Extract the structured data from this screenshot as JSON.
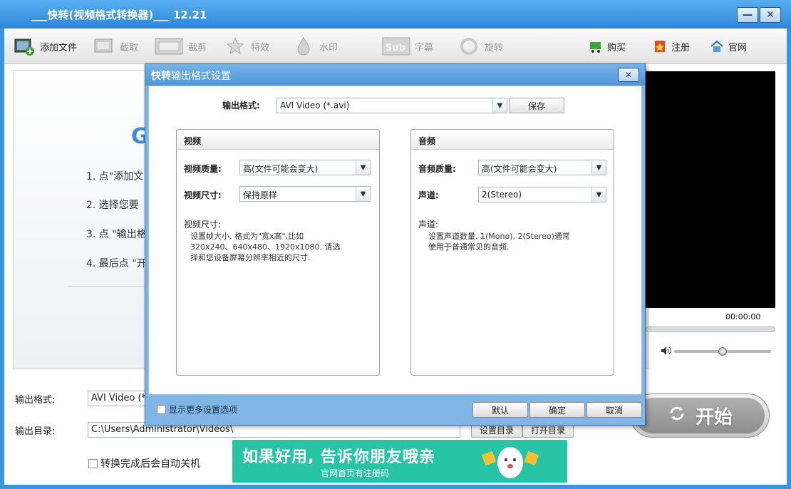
{
  "app": {
    "title": "___快转(视频格式转换器)___ 12.21",
    "minimize_icon": "minimize-icon",
    "close_icon": "close-icon"
  },
  "toolbar": {
    "add_file": "添加文件",
    "clip": "截取",
    "crop": "裁剪",
    "effects": "特效",
    "watermark": "水印",
    "subtitle": "字幕",
    "rotate": "旋转",
    "buy": "购买",
    "register": "注册",
    "website": "官网"
  },
  "guide": {
    "big_letter": "G",
    "step1": "1. 点\"添加文",
    "step2": "2. 选择您要",
    "step3": "3. 点 \"输出格",
    "step4": "4. 最后点 \"开"
  },
  "preview": {
    "time": "00:00:00",
    "progress": 0,
    "volume": 0.5
  },
  "bottom": {
    "output_format_label": "输出格式:",
    "output_format_value": "AVI Video (*.",
    "output_dir_label": "输出目录:",
    "output_dir_value": "C:\\Users\\Administrator\\Videos\\",
    "set_dir_button": "设置目录",
    "open_dir_button": "打开目录",
    "auto_shutdown": "转换完成后会自动关机",
    "start_button": "开始"
  },
  "banner": {
    "main": "如果好用, 告诉你朋友哦亲",
    "sub": "官网首页有注册码"
  },
  "dialog": {
    "title_bold": "快转",
    "title_rest": "输出格式设置",
    "format_label": "输出格式:",
    "format_value": "AVI Video (*.avi)",
    "save_button": "保存",
    "video": {
      "heading": "视频",
      "quality_label": "视频质量:",
      "quality_value": "高(文件可能会变大)",
      "size_label": "视频尺寸:",
      "size_value": "保持原样",
      "desc_title": "视频尺寸:",
      "desc_line1": "设置帧大小. 格式为\"宽x高\",比如",
      "desc_line2": "320x240、640x480、1920x1080. 请选",
      "desc_line3": "择和您设备屏幕分辨率相近的尺寸."
    },
    "audio": {
      "heading": "音频",
      "quality_label": "音频质量:",
      "quality_value": "高(文件可能会变大)",
      "channel_label": "声道:",
      "channel_value": "2(Stereo)",
      "desc_title": "声道:",
      "desc_line1": "设置声道数量. 1(Mono), 2(Stereo)通常",
      "desc_line2": "使用于普通常见的音频."
    },
    "more_options": "显示更多设置选项",
    "default_button": "默认",
    "ok_button": "确定",
    "cancel_button": "取消"
  },
  "colors": {
    "titlebar": "#2e86d8",
    "banner": "#27c4a6",
    "preview_bg": "#000000"
  }
}
